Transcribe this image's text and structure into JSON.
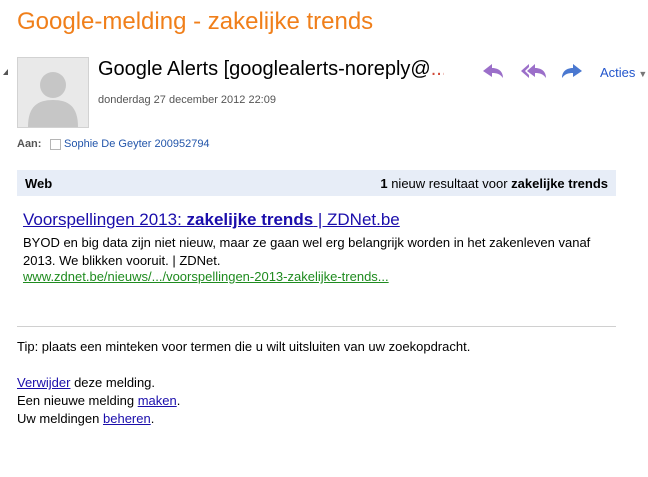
{
  "email": {
    "subject": "Google-melding - zakelijke trends",
    "sender": "Google Alerts [googlealerts-noreply@",
    "sender_ellipsis": "...",
    "date": "donderdag 27 december 2012 22:09",
    "actions_label": "Acties",
    "to_label": "Aan:",
    "recipient": "Sophie De Geyter 200952794"
  },
  "web_bar": {
    "label": "Web",
    "count": "1",
    "text": " nieuw resultaat voor ",
    "query": "zakelijke trends"
  },
  "result": {
    "title_prefix": "Voorspellingen 2013: ",
    "title_bold": "zakelijke trends",
    "title_suffix": " | ZDNet.be",
    "snippet": "BYOD en big data zijn niet nieuw, maar ze gaan wel erg belangrijk worden in het zakenleven vanaf 2013. We blikken vooruit. | ZDNet.",
    "url": "www.zdnet.be/nieuws/.../voorspellingen-2013-zakelijke-trends..."
  },
  "tip": "Tip: plaats een minteken voor termen die u wilt uitsluiten van uw zoekopdracht.",
  "footer": {
    "delete_link": "Verwijder",
    "delete_rest": " deze melding.",
    "new_prefix": "Een nieuwe melding ",
    "new_link": "maken",
    "new_suffix": ".",
    "manage_prefix": "Uw meldingen ",
    "manage_link": "beheren",
    "manage_suffix": "."
  },
  "colors": {
    "subject": "#f07f1a",
    "reply_icons": "#9b6fc9",
    "forward_icon": "#4a78d0",
    "link": "#1a0dab",
    "url_green": "#1f8b1f",
    "web_bar_bg": "#e7edf7"
  },
  "icons": [
    "collapse-triangle-icon",
    "avatar-silhouette-icon",
    "reply-icon",
    "reply-all-icon",
    "forward-icon",
    "dropdown-caret-icon",
    "checkbox-icon"
  ]
}
